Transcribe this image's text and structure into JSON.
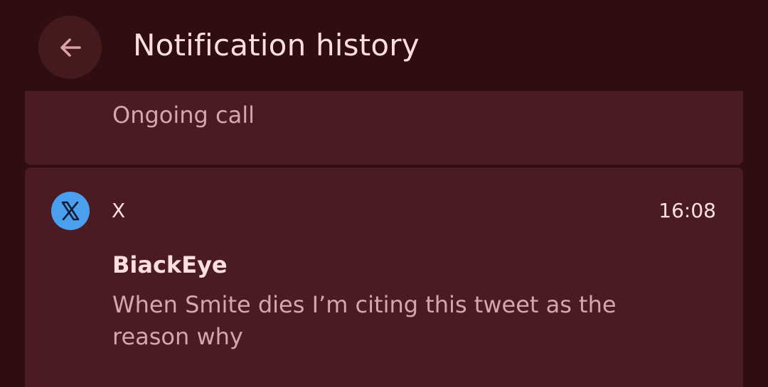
{
  "header": {
    "title": "Notification history",
    "back_icon": "arrow-left-icon"
  },
  "notifications": [
    {
      "body": "Ongoing call"
    },
    {
      "app_name": "X",
      "app_icon": "x-logo-icon",
      "time": "16:08",
      "sender": "BiackEye",
      "message": "When Smite dies I’m citing this tweet as the reason why"
    }
  ],
  "colors": {
    "background": "#2f0d12",
    "card": "#4b1b24",
    "title_text": "#fbdfe0",
    "secondary_text": "#d2a8ad",
    "x_icon_bg": "#4a9fee"
  }
}
